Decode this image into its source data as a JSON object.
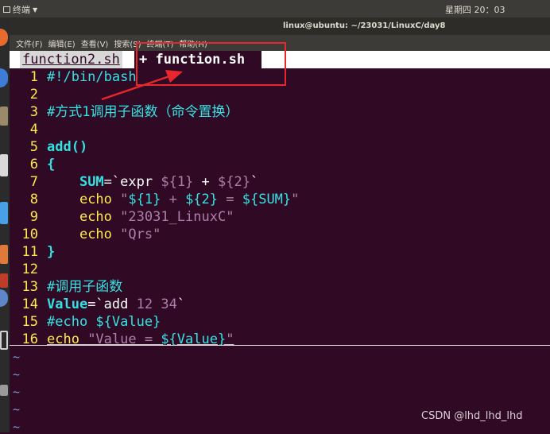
{
  "top_panel": {
    "app_name": "终端",
    "clock": "星期四 20：03"
  },
  "window": {
    "title": "linux@ubuntu: ~/23031/LinuxC/day8"
  },
  "menu": [
    {
      "label": "文件(F)"
    },
    {
      "label": "编辑(E)"
    },
    {
      "label": "查看(V)"
    },
    {
      "label": "搜索(S)"
    },
    {
      "label": "终端(T)"
    },
    {
      "label": "帮助(H)"
    }
  ],
  "tabs": {
    "inactive": "function2.sh",
    "active_prefix": "+",
    "active": "function.sh"
  },
  "code": {
    "l1": {
      "n": "1",
      "t": "#!/bin/bash"
    },
    "l2": {
      "n": "2"
    },
    "l3": {
      "n": "3",
      "t": "#方式1调用子函数（命令置换）"
    },
    "l4": {
      "n": "4"
    },
    "l5": {
      "n": "5",
      "t": "add()"
    },
    "l6": {
      "n": "6",
      "t": "{"
    },
    "l7": {
      "n": "7",
      "a": "SUM",
      "b": "=`",
      "c": "expr ",
      "d": "${1}",
      "e": " + ",
      "f": "${2}",
      "g": "`"
    },
    "l8": {
      "n": "8",
      "a": "echo ",
      "b": "\"",
      "c": "${1}",
      "d": " + ",
      "e": "${2}",
      "f": " = ",
      "g": "${SUM}",
      "h": "\""
    },
    "l9": {
      "n": "9",
      "a": "echo ",
      "b": "\"23031_LinuxC\""
    },
    "l10": {
      "n": "10",
      "a": "echo ",
      "b": "\"Qrs\""
    },
    "l11": {
      "n": "11",
      "t": "}"
    },
    "l12": {
      "n": "12"
    },
    "l13": {
      "n": "13",
      "t": "#调用子函数"
    },
    "l14": {
      "n": "14",
      "a": "Value",
      "b": "=`",
      "c": "add ",
      "d": "12 34",
      "e": "`"
    },
    "l15": {
      "n": "15",
      "t": "#echo ${Value}"
    },
    "l16": {
      "n": "16",
      "a": "echo ",
      "b": "\"Value = ",
      "c": "${Value}",
      "d": "\""
    }
  },
  "tilde": "~",
  "watermark": "CSDN @lhd_lhd_lhd",
  "colors": {
    "background": "#300a24",
    "comment": "#34e2e2",
    "string": "#ad7fa8",
    "line_number": "#fce94f",
    "annotation": "#e8272c"
  }
}
